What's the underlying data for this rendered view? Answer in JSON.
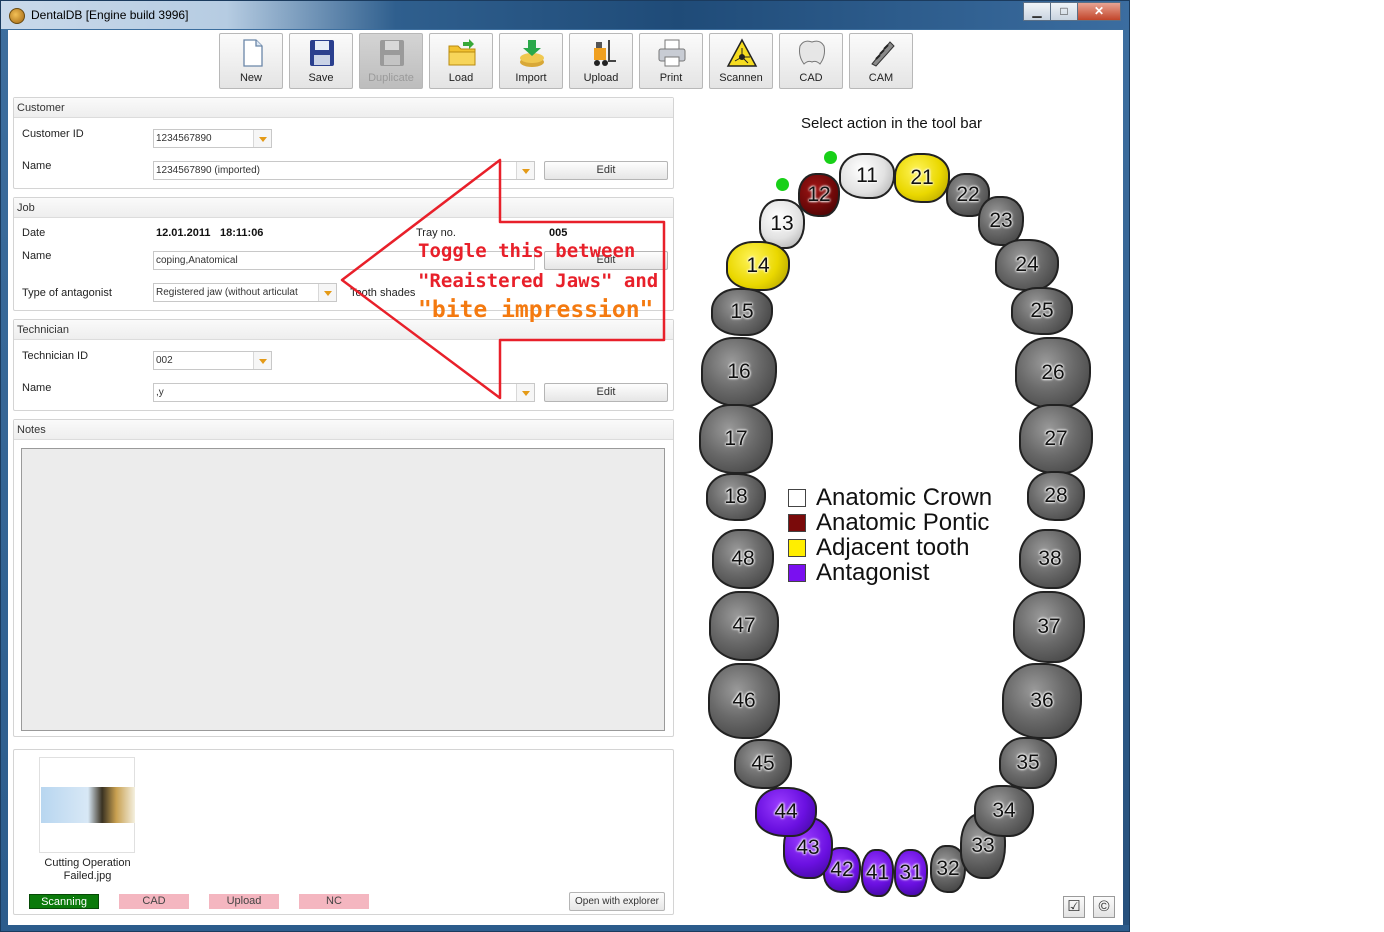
{
  "window": {
    "title": "DentalDB [Engine build 3996]",
    "minimize": "▁",
    "maximize": "□",
    "close": "✕"
  },
  "toolbar": [
    {
      "label": "New",
      "icon": "new-document-icon",
      "enabled": true
    },
    {
      "label": "Save",
      "icon": "floppy-disk-icon",
      "enabled": true
    },
    {
      "label": "Duplicate",
      "icon": "floppy-disk-icon",
      "enabled": false
    },
    {
      "label": "Load",
      "icon": "folder-icon",
      "enabled": true
    },
    {
      "label": "Import",
      "icon": "import-icon",
      "enabled": true
    },
    {
      "label": "Upload",
      "icon": "forklift-icon",
      "enabled": true
    },
    {
      "label": "Print",
      "icon": "printer-icon",
      "enabled": true
    },
    {
      "label": "Scannen",
      "icon": "laser-icon",
      "enabled": true
    },
    {
      "label": "CAD",
      "icon": "tooth-crown-icon",
      "enabled": true
    },
    {
      "label": "CAM",
      "icon": "milling-tool-icon",
      "enabled": true
    }
  ],
  "customer": {
    "header": "Customer",
    "id_label": "Customer ID",
    "id_value": "1234567890",
    "name_label": "Name",
    "name_value": "1234567890 (imported)",
    "edit": "Edit"
  },
  "job": {
    "header": "Job",
    "date_label": "Date",
    "date_value": "12.01.2011",
    "time_value": "18:11:06",
    "tray_label": "Tray no.",
    "tray_value": "005",
    "name_label": "Name",
    "name_value": "coping,Anatomical",
    "edit": "Edit",
    "antagonist_label": "Type of antagonist",
    "antagonist_value": "Registered jaw (without articulat",
    "shades_label": "Tooth shades"
  },
  "technician": {
    "header": "Technician",
    "id_label": "Technician ID",
    "id_value": "002",
    "name_label": "Name",
    "name_value": ",y",
    "edit": "Edit"
  },
  "notes": {
    "header": "Notes"
  },
  "files": {
    "thumbnail_name": "Cutting Operation Failed.jpg",
    "open_explorer": "Open with explorer",
    "status": [
      {
        "label": "Scanning",
        "state": "done",
        "color": "#0b7a0b"
      },
      {
        "label": "CAD",
        "state": "pending",
        "color": "#f4b6c0"
      },
      {
        "label": "Upload",
        "state": "pending",
        "color": "#f4b6c0"
      },
      {
        "label": "NC",
        "state": "pending",
        "color": "#f4b6c0"
      }
    ]
  },
  "annotation": {
    "line1": "Toggle this between",
    "line2": "\"Reaistered Jaws\" and",
    "line3": "\"bite impression\"",
    "color_red": "#e8202a",
    "color_orange": "#f47a10"
  },
  "chart": {
    "hint": "Select action in the tool bar",
    "legend": [
      {
        "label": "Anatomic Crown",
        "color": "#ffffff"
      },
      {
        "label": "Anatomic Pontic",
        "color": "#7a0a0a"
      },
      {
        "label": "Adjacent tooth",
        "color": "#ffee00"
      },
      {
        "label": "Antagonist",
        "color": "#7a10f0"
      }
    ],
    "teeth": [
      {
        "num": "11",
        "type": "crown"
      },
      {
        "num": "12",
        "type": "pontic"
      },
      {
        "num": "13",
        "type": "crown"
      },
      {
        "num": "14",
        "type": "adjacent"
      },
      {
        "num": "15",
        "type": "none"
      },
      {
        "num": "16",
        "type": "none"
      },
      {
        "num": "17",
        "type": "none"
      },
      {
        "num": "18",
        "type": "none"
      },
      {
        "num": "21",
        "type": "adjacent"
      },
      {
        "num": "22",
        "type": "none"
      },
      {
        "num": "23",
        "type": "none"
      },
      {
        "num": "24",
        "type": "none"
      },
      {
        "num": "25",
        "type": "none"
      },
      {
        "num": "26",
        "type": "none"
      },
      {
        "num": "27",
        "type": "none"
      },
      {
        "num": "28",
        "type": "none"
      },
      {
        "num": "31",
        "type": "antagonist"
      },
      {
        "num": "32",
        "type": "none"
      },
      {
        "num": "33",
        "type": "none"
      },
      {
        "num": "34",
        "type": "none"
      },
      {
        "num": "35",
        "type": "none"
      },
      {
        "num": "36",
        "type": "none"
      },
      {
        "num": "37",
        "type": "none"
      },
      {
        "num": "38",
        "type": "none"
      },
      {
        "num": "41",
        "type": "antagonist"
      },
      {
        "num": "42",
        "type": "antagonist"
      },
      {
        "num": "43",
        "type": "antagonist"
      },
      {
        "num": "44",
        "type": "antagonist"
      },
      {
        "num": "45",
        "type": "none"
      },
      {
        "num": "46",
        "type": "none"
      },
      {
        "num": "47",
        "type": "none"
      },
      {
        "num": "48",
        "type": "none"
      }
    ],
    "check_button": "☑",
    "copyright_button": "©"
  }
}
